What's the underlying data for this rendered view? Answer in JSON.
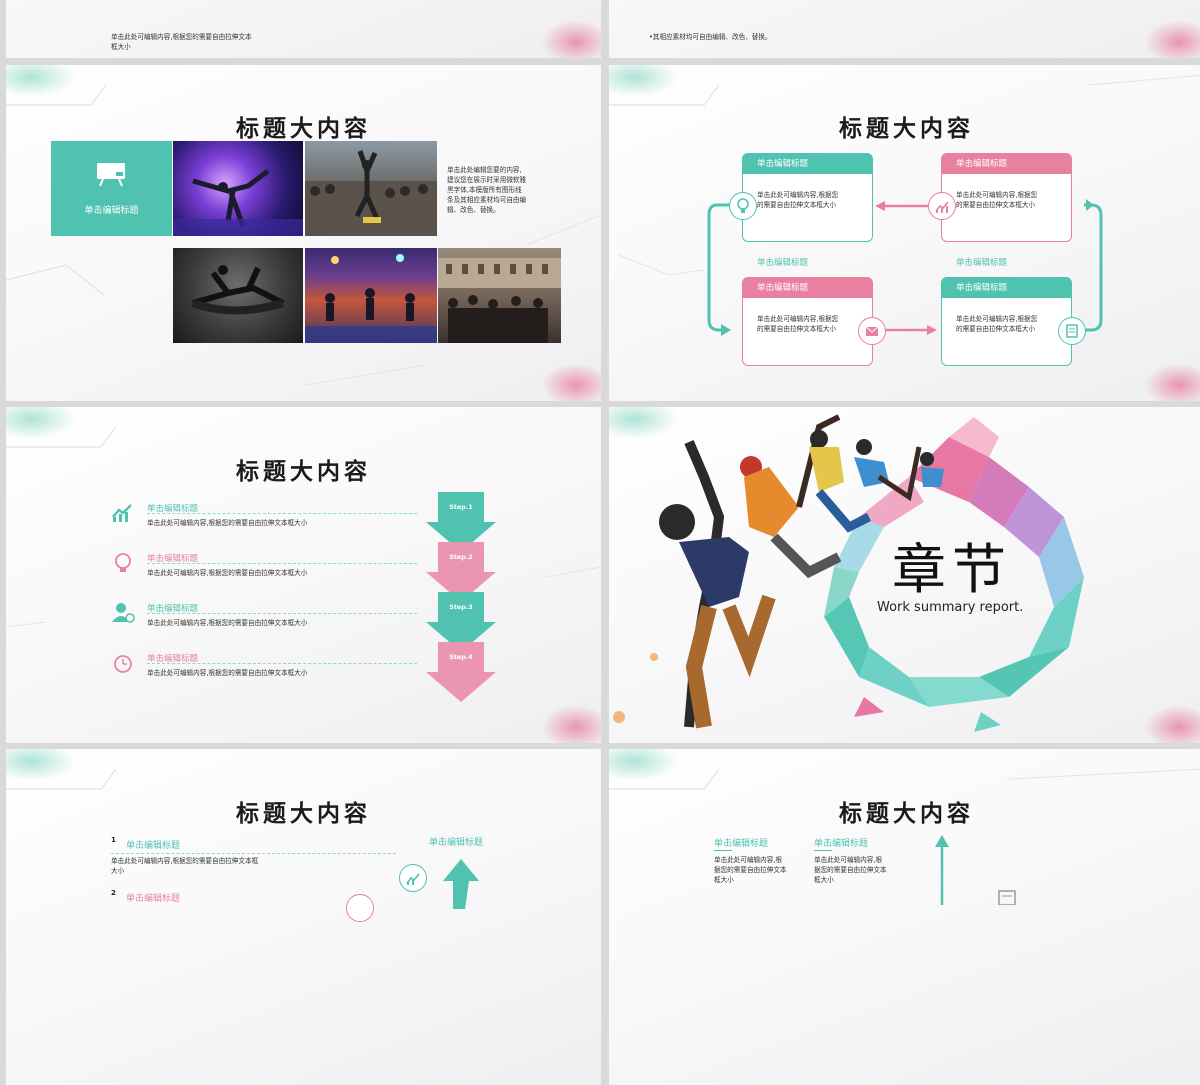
{
  "slides": {
    "top_left": {
      "text_line1": "单击此处可编辑内容,根据您的需要自由拉伸文本",
      "text_line2": "框大小"
    },
    "top_right": {
      "text": "•其相应素材均可自由编辑、改色、替换。"
    },
    "gallery": {
      "title": "标题大内容",
      "tile_label": "单击编辑标题",
      "tile_icon": "presentation-board-icon",
      "body": [
        "单击此处编辑您要的内容,",
        "建议您在展示时采用微软雅",
        "黑字体,本模版所有图形线",
        "条及其相应素材均可自由编",
        "辑、改色、替换。"
      ],
      "photos": [
        "dancer-stage",
        "dancer-crowd",
        "dancer-jump",
        "dance-stage-group",
        "street-crowd"
      ]
    },
    "cycle": {
      "title": "标题大内容",
      "boxes": [
        {
          "title": "单击编辑标题",
          "text": [
            "单击此处可编辑内容,根据您",
            "的需要自由拉伸文本框大小"
          ],
          "icon": "lightbulb-icon",
          "color": "teal"
        },
        {
          "title": "单击编辑标题",
          "text": [
            "单击此处可编辑内容,根据您",
            "的需要自由拉伸文本框大小"
          ],
          "icon": "chart-icon",
          "color": "pink"
        },
        {
          "title": "单击编辑标题",
          "text": [
            "单击此处可编辑内容,根据您",
            "的需要自由拉伸文本框大小"
          ],
          "icon": "mail-icon",
          "color": "pink"
        },
        {
          "title": "单击编辑标题",
          "text": [
            "单击此处可编辑内容,根据您",
            "的需要自由拉伸文本框大小"
          ],
          "icon": "document-icon",
          "color": "teal"
        }
      ],
      "mid_labels": [
        "单击编辑标题",
        "单击编辑标题"
      ]
    },
    "steps": {
      "title": "标题大内容",
      "items": [
        {
          "title": "单击编辑标题",
          "desc": "单击此处可编辑内容,根据您的需要自由拉伸文本框大小",
          "step": "Step.1",
          "icon": "growth-chart-icon",
          "color": "teal"
        },
        {
          "title": "单击编辑标题",
          "desc": "单击此处可编辑内容,根据您的需要自由拉伸文本框大小",
          "step": "Step.2",
          "icon": "lightbulb-icon",
          "color": "pink"
        },
        {
          "title": "单击编辑标题",
          "desc": "单击此处可编辑内容,根据您的需要自由拉伸文本框大小",
          "step": "Step.3",
          "icon": "add-user-icon",
          "color": "teal"
        },
        {
          "title": "单击编辑标题",
          "desc": "单击此处可编辑内容,根据您的需要自由拉伸文本框大小",
          "step": "Step.4",
          "icon": "alarm-clock-icon",
          "color": "pink"
        }
      ]
    },
    "chapter": {
      "heading": "章节",
      "subtitle": "Work summary report."
    },
    "bottom_left": {
      "title": "标题大内容",
      "item1_num": "1",
      "item1_title": "单击编辑标题",
      "item1_text": [
        "单击此处可编辑内容,根据您的需要自由拉伸文本框",
        "大小"
      ],
      "item2_num": "2",
      "item2_title": "单击编辑标题",
      "right_label": "单击编辑标题"
    },
    "bottom_right": {
      "title": "标题大内容",
      "cols": [
        {
          "title": "单击编辑标题",
          "text": [
            "单击此处可编辑内容,根",
            "据您的需要自由拉伸文本",
            "框大小"
          ]
        },
        {
          "title": "单击编辑标题",
          "text": [
            "单击此处可编辑内容,根",
            "据您的需要自由拉伸文本",
            "框大小"
          ]
        }
      ]
    }
  },
  "colors": {
    "teal": "#4fc2b0",
    "pink": "#e8809f",
    "text": "#333333"
  }
}
